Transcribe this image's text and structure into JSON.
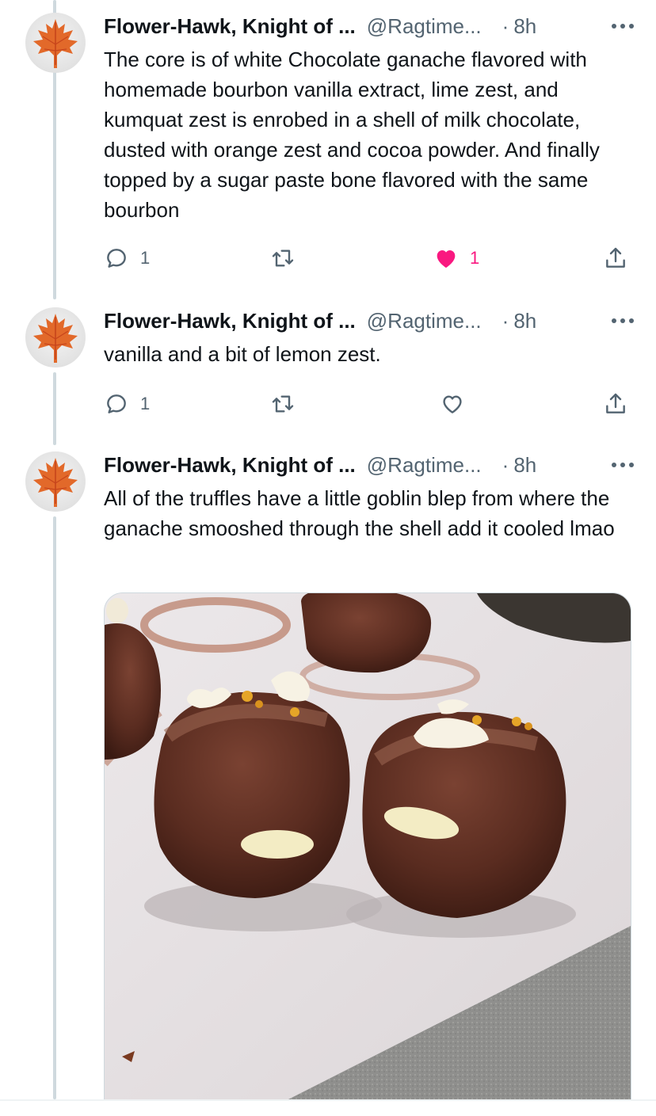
{
  "tweets": [
    {
      "author": "Flower-Hawk, Knight of ...",
      "handle": "@Ragtime...",
      "separator": "·",
      "time": "8h",
      "text": "The core is of white Chocolate ganache flavored with homemade bourbon vanilla extract, lime zest, and kumquat zest is enrobed in a shell of milk chocolate, dusted with orange zest and cocoa powder. And finally topped by a sugar paste bone flavored with the same bourbon",
      "reply_count": "1",
      "retweet_count": "",
      "like_count": "1",
      "liked": true
    },
    {
      "author": "Flower-Hawk, Knight of ...",
      "handle": "@Ragtime...",
      "separator": "·",
      "time": "8h",
      "text": "vanilla and a bit of lemon zest.",
      "reply_count": "1",
      "retweet_count": "",
      "like_count": "",
      "liked": false
    },
    {
      "author": "Flower-Hawk, Knight of ...",
      "handle": "@Ragtime...",
      "separator": "·",
      "time": "8h",
      "text": "All of the truffles have a little goblin blep from where the ganache smooshed through the shell add it cooled lmao"
    }
  ],
  "icons": {
    "avatar": "maple-leaf-avatar",
    "more": "more-horizontal-icon",
    "reply": "reply-icon",
    "retweet": "retweet-icon",
    "like": "heart-icon",
    "share": "share-icon"
  },
  "colors": {
    "text": "#0f1419",
    "secondary": "#536471",
    "like_active": "#f91880",
    "thread_line": "#cfd9de"
  }
}
